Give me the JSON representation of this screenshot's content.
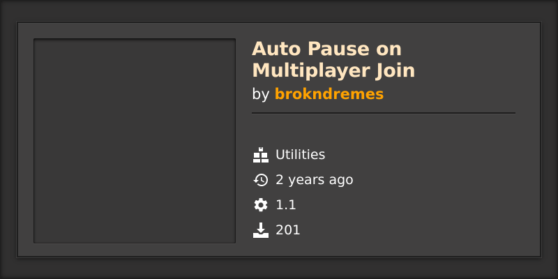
{
  "mod": {
    "title": "Auto Pause on Multiplayer Join",
    "author_prefix": "by",
    "author": "brokndremes"
  },
  "meta": [
    {
      "icon": "category-icon",
      "value": "Utilities"
    },
    {
      "icon": "history-icon",
      "value": "2 years ago"
    },
    {
      "icon": "gear-icon",
      "value": "1.1"
    },
    {
      "icon": "download-icon",
      "value": "201"
    }
  ],
  "colors": {
    "title": "#ffe6c0",
    "author": "#ffa200",
    "card_background": "#414040",
    "page_background": "#313030"
  }
}
